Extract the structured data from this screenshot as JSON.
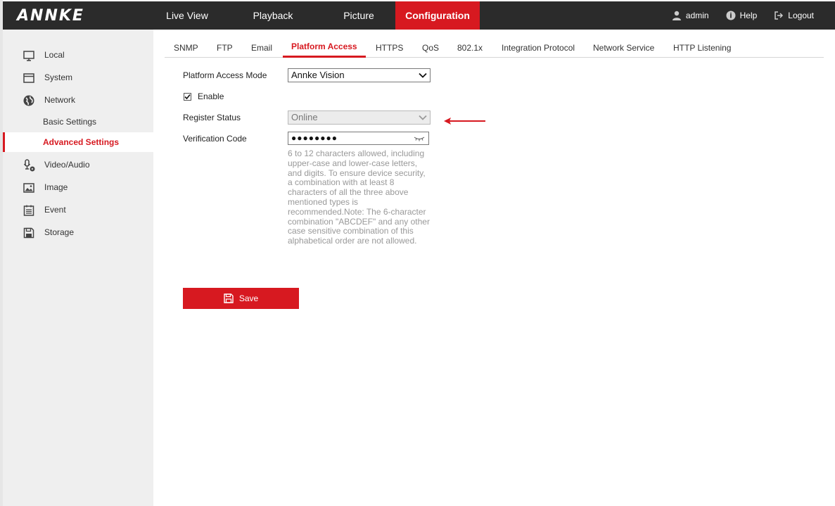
{
  "brand": "ANNKE",
  "nav": {
    "live_view": "Live View",
    "playback": "Playback",
    "picture": "Picture",
    "configuration": "Configuration"
  },
  "user": {
    "name": "admin",
    "help": "Help",
    "logout": "Logout"
  },
  "sidebar": {
    "items": [
      {
        "label": "Local",
        "icon": "monitor-icon"
      },
      {
        "label": "System",
        "icon": "window-icon"
      },
      {
        "label": "Network",
        "icon": "globe-icon"
      },
      {
        "label": "Basic Settings"
      },
      {
        "label": "Advanced Settings"
      },
      {
        "label": "Video/Audio",
        "icon": "microphone-camera-icon"
      },
      {
        "label": "Image",
        "icon": "image-icon"
      },
      {
        "label": "Event",
        "icon": "event-list-icon"
      },
      {
        "label": "Storage",
        "icon": "floppy-disk-icon"
      }
    ],
    "active_item": "Advanced Settings"
  },
  "tabs": [
    "SNMP",
    "FTP",
    "Email",
    "Platform Access",
    "HTTPS",
    "QoS",
    "802.1x",
    "Integration Protocol",
    "Network Service",
    "HTTP Listening"
  ],
  "active_tab": "Platform Access",
  "form": {
    "mode_label": "Platform Access Mode",
    "mode_value": "Annke Vision",
    "enable_label": "Enable",
    "enable_checked": true,
    "register_label": "Register Status",
    "register_value": "Online",
    "verification_label": "Verification Code",
    "verification_value": "●●●●●●●●",
    "hint": "6 to 12 characters allowed, including upper-case and lower-case letters, and digits. To ensure device security, a combination with at least 8 characters of all the three above mentioned types is recommended.Note: The 6-character combination \"ABCDEF\" and any other case sensitive combination of this alphabetical order are not allowed."
  },
  "save_label": "Save",
  "colors": {
    "accent": "#d71920",
    "topbar": "#2b2b2b",
    "sidebar": "#efefef",
    "hint_text": "#999999"
  }
}
